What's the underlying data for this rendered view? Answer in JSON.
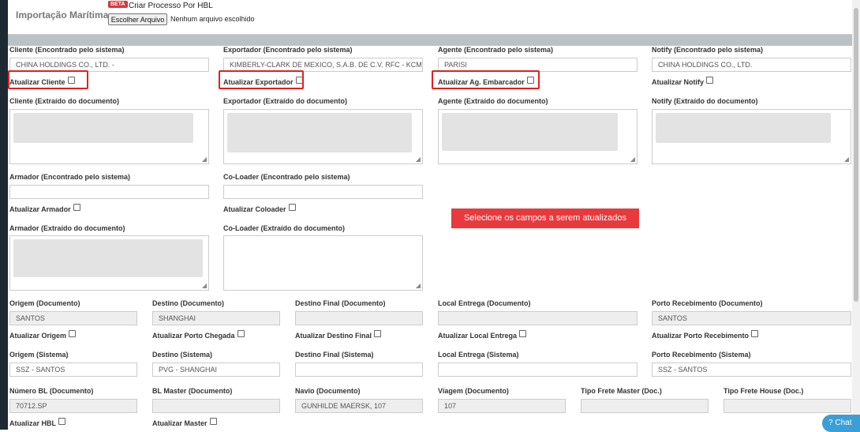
{
  "header": {
    "title": "Importação Marítima",
    "beta_badge": "BETA",
    "hbl_title": "Criar Processo Por HBL",
    "file_button": "Escolher Arquivo",
    "file_status": "Nenhum arquivo escolhido"
  },
  "parties_system": {
    "cliente": {
      "label": "Cliente (Encontrado pelo sistema)",
      "value": "CHINA HOLDINGS CO., LTD. -",
      "update_label": "Atualizar Cliente"
    },
    "exportador": {
      "label": "Exportador (Encontrado pelo sistema)",
      "value": "KIMBERLY-CLARK DE MEXICO, S.A.B. DE C.V.  RFC - KCM",
      "update_label": "Atualizar Exportador"
    },
    "agente": {
      "label": "Agente (Encontrado pelo sistema)",
      "value": "PARISI",
      "update_label": "Atualizar Ag. Embarcador"
    },
    "notify": {
      "label": "Notify (Encontrado pelo sistema)",
      "value": "CHINA HOLDINGS CO., LTD.",
      "update_label": "Atualizar Notify"
    }
  },
  "parties_doc": {
    "cliente": "Cliente (Extraído do documento)",
    "exportador": "Exportador (Extraído do documento)",
    "agente": "Agente (Extraído do documento)",
    "notify": "Notify (Extraído do documento)"
  },
  "armador": {
    "label": "Armador (Encontrado pelo sistema)",
    "value": "",
    "update_label": "Atualizar Armador",
    "doc_label": "Armador (Extraído do documento)"
  },
  "coloader": {
    "label": "Co-Loader (Encontrado pelo sistema)",
    "value": "",
    "update_label": "Atualizar Coloader",
    "doc_label": "Co-Loader (Extraído do documento)"
  },
  "alert": "Selecione os campos a serem atualizados",
  "route_doc": {
    "origem": {
      "label": "Origem (Documento)",
      "value": "SANTOS",
      "update_label": "Atualizar Origem"
    },
    "destino": {
      "label": "Destino (Documento)",
      "value": "SHANGHAI",
      "update_label": "Atualizar Porto Chegada"
    },
    "destino_final": {
      "label": "Destino Final (Documento)",
      "value": "",
      "update_label": "Atualizar Destino Final"
    },
    "local_entrega": {
      "label": "Local Entrega (Documento)",
      "value": "",
      "update_label": "Atualizar Local Entrega"
    },
    "porto_recebimento": {
      "label": "Porto Recebimento (Documento)",
      "value": "SANTOS",
      "update_label": "Atualizar Porto Recebimento"
    }
  },
  "route_sys": {
    "origem": {
      "label": "Origem (Sistema)",
      "value": "SSZ - SANTOS"
    },
    "destino": {
      "label": "Destino (Sistema)",
      "value": "PVG - SHANGHAI"
    },
    "destino_final": {
      "label": "Destino Final (Sistema)",
      "value": ""
    },
    "local_entrega": {
      "label": "Local Entrega (Sistema)",
      "value": ""
    },
    "porto_recebimento": {
      "label": "Porto Recebimento (Sistema)",
      "value": "SSZ - SANTOS"
    }
  },
  "bl": {
    "numero": {
      "label": "Número BL (Documento)",
      "value": "70712.SP",
      "update_label": "Atualizar HBL"
    },
    "master": {
      "label": "BL Master (Documento)",
      "value": "",
      "update_label": "Atualizar Master"
    },
    "navio": {
      "label": "Navio (Documento)",
      "value": "GUNHILDE MAERSK, 107"
    },
    "viagem": {
      "label": "Viagem (Documento)",
      "value": "107"
    },
    "frete_master": {
      "label": "Tipo Frete Master (Doc.)",
      "value": ""
    },
    "frete_house": {
      "label": "Tipo Frete House (Doc.)",
      "value": ""
    }
  },
  "chat": {
    "icon": "help-circle-icon",
    "label": "Chat"
  },
  "colors": {
    "accent_red": "#e02020",
    "alert_bg": "#e8393c",
    "chat_bg": "#3a9fd6"
  }
}
